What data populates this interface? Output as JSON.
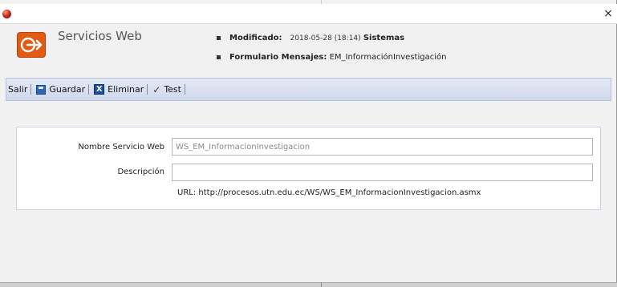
{
  "window": {
    "close_glyph": "×"
  },
  "header": {
    "module_title": "Servicios Web",
    "modified_label": "Modificado:",
    "modified_date": "2018-05-28 (18:14)",
    "modified_user": "Sistemas",
    "form_label": "Formulario Mensajes:",
    "form_value": "EM_InformaciónInvestigación"
  },
  "toolbar": {
    "exit_label": "Salir",
    "save_label": "Guardar",
    "delete_label": "Eliminar",
    "delete_glyph": "X",
    "check_glyph": "✓",
    "test_label": "Test"
  },
  "form": {
    "name_label": "Nombre Servicio Web",
    "name_value": "WS_EM_InformacionInvestigacion",
    "description_label": "Descripción",
    "description_value": "",
    "url_text": "URL: http://procesos.utn.edu.ec/WS/WS_EM_InformacionInvestigacion.asmx"
  },
  "colors": {
    "accent": "#e25b12",
    "toolbar_bg": "#d6dff0"
  },
  "icons": [
    "app-icon",
    "close-icon",
    "login-arrow-icon",
    "save-icon",
    "delete-icon",
    "check-icon"
  ]
}
